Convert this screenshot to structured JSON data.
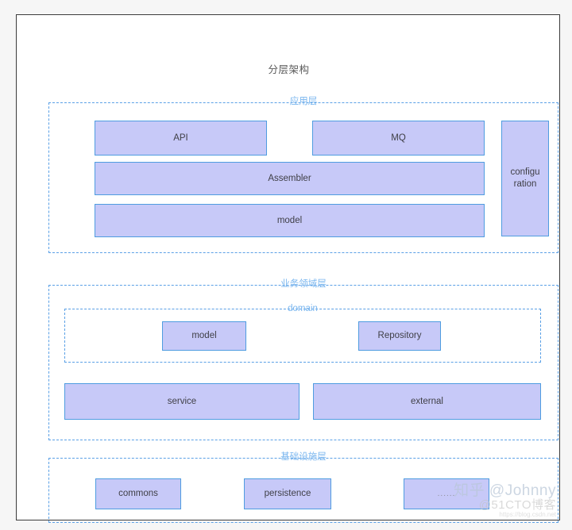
{
  "diagram": {
    "title": "分层架构",
    "layers": [
      {
        "id": "application",
        "label": "应用层",
        "boxes": [
          {
            "label": "API"
          },
          {
            "label": "MQ"
          },
          {
            "label": "Assembler"
          },
          {
            "label": "model"
          },
          {
            "label": "configu\nration"
          }
        ]
      },
      {
        "id": "domain",
        "label": "业务领域层",
        "sublabel": "domain",
        "boxes": [
          {
            "label": "model"
          },
          {
            "label": "Repository"
          },
          {
            "label": "service"
          },
          {
            "label": "external"
          }
        ]
      },
      {
        "id": "infrastructure",
        "label": "基础设施层",
        "boxes": [
          {
            "label": "commons"
          },
          {
            "label": "persistence"
          },
          {
            "label": "......"
          }
        ]
      }
    ]
  },
  "watermark": {
    "main": "知乎 @Johnny",
    "sub": "@51CTO博客",
    "url": "https://blog.csdn.net"
  },
  "colors": {
    "box_fill": "#c7c9f8",
    "box_border": "#4f9ce0",
    "layer_border": "#5aa0e6",
    "layer_label": "#7ab6ef",
    "frame_border": "#3b3b3b",
    "text": "#3f3f46"
  }
}
